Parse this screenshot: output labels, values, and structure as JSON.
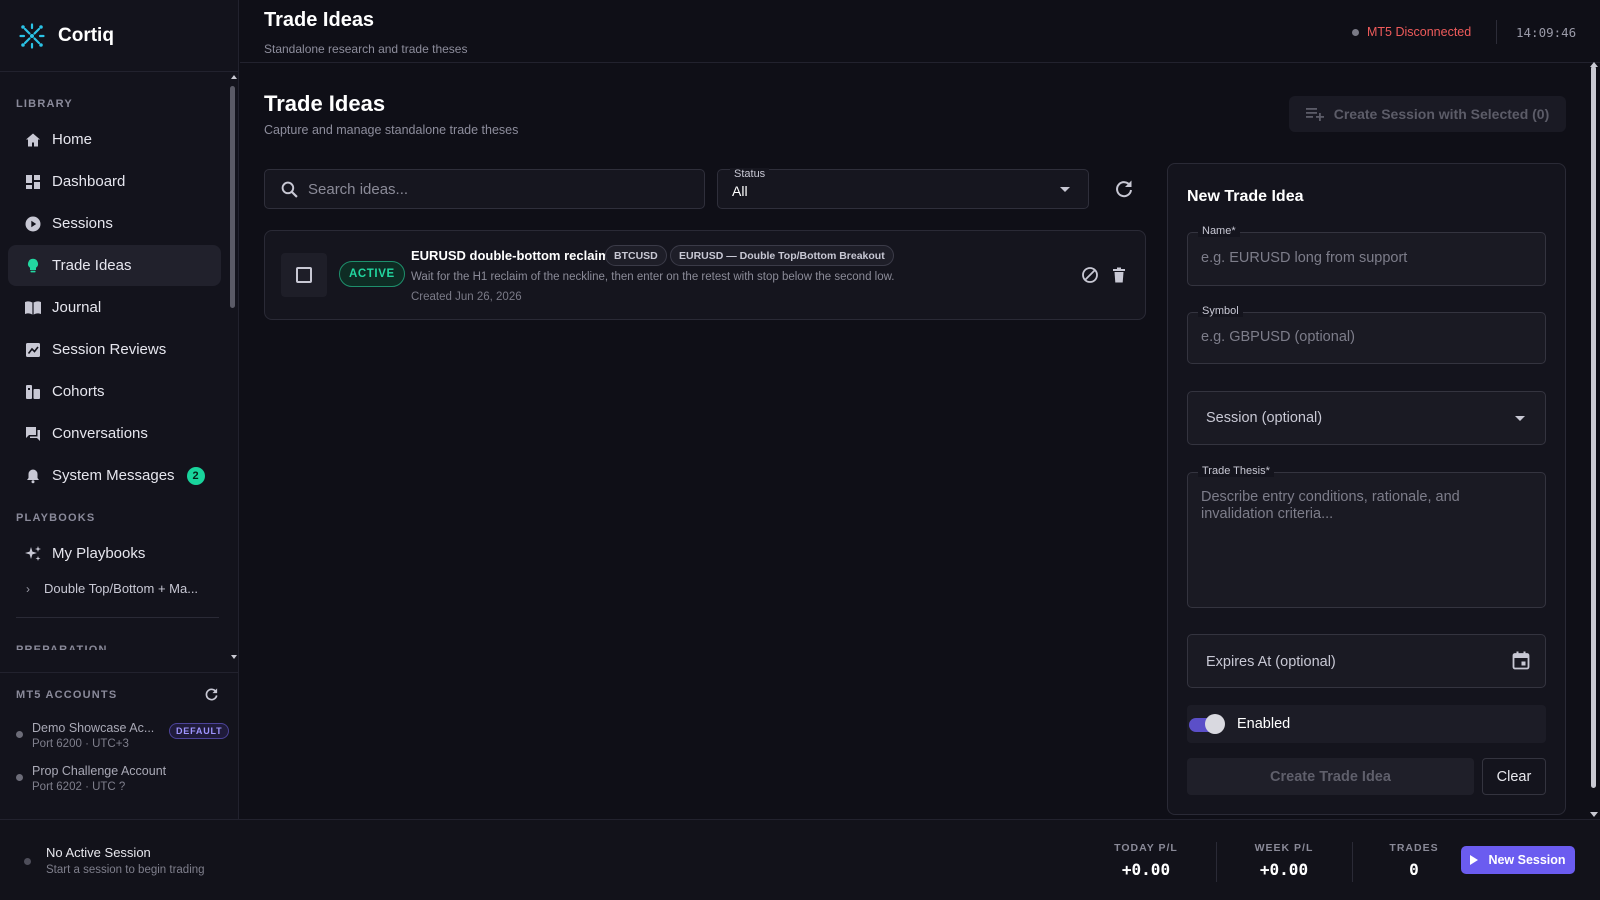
{
  "app": {
    "name": "Cortiq"
  },
  "sidebar": {
    "library_title": "LIBRARY",
    "items": [
      {
        "label": "Home",
        "icon": "home-icon"
      },
      {
        "label": "Dashboard",
        "icon": "dashboard-icon"
      },
      {
        "label": "Sessions",
        "icon": "play-circle-icon"
      },
      {
        "label": "Trade Ideas",
        "icon": "lightbulb-icon",
        "active": true
      },
      {
        "label": "Journal",
        "icon": "book-icon"
      },
      {
        "label": "Session Reviews",
        "icon": "review-icon"
      },
      {
        "label": "Cohorts",
        "icon": "cohorts-icon"
      },
      {
        "label": "Conversations",
        "icon": "chat-icon"
      },
      {
        "label": "System Messages",
        "icon": "bell-icon",
        "badge": "2"
      }
    ],
    "playbooks_title": "PLAYBOOKS",
    "my_playbooks": "My Playbooks",
    "playbook_child": "Double Top/Bottom + Ma...",
    "clipped_section": "PREPARATION",
    "accounts_title": "MT5 ACCOUNTS",
    "accounts": [
      {
        "name": "Demo Showcase Ac...",
        "sub": "Port 6200 · UTC+3",
        "tag": "DEFAULT"
      },
      {
        "name": "Prop Challenge Account",
        "sub": "Port 6202 · UTC ?"
      }
    ]
  },
  "header": {
    "title": "Trade Ideas",
    "subtitle": "Standalone research and trade theses",
    "connection": "MT5 Disconnected",
    "clock": "14:09:46"
  },
  "main": {
    "title": "Trade Ideas",
    "subtitle": "Capture and manage standalone trade theses",
    "create_session_label": "Create Session with Selected (0)",
    "search_placeholder": "Search ideas...",
    "status_label": "Status",
    "status_value": "All",
    "ideas": [
      {
        "status": "ACTIVE",
        "title": "EURUSD double-bottom reclaim",
        "symbol": "BTCUSD",
        "playbook": "EURUSD — Double Top/Bottom Breakout",
        "description": "Wait for the H1 reclaim of the neckline, then enter on the retest with stop below the second low.",
        "created": "Created Jun 26, 2026"
      }
    ]
  },
  "form": {
    "title": "New Trade Idea",
    "name_label": "Name*",
    "name_placeholder": "e.g. EURUSD long from support",
    "symbol_label": "Symbol",
    "symbol_placeholder": "e.g. GBPUSD (optional)",
    "session_placeholder": "Session (optional)",
    "thesis_label": "Trade Thesis*",
    "thesis_placeholder": "Describe entry conditions, rationale, and invalidation criteria...",
    "expires_placeholder": "Expires At (optional)",
    "enabled_label": "Enabled",
    "submit_label": "Create Trade Idea",
    "clear_label": "Clear"
  },
  "footer": {
    "session_title": "No Active Session",
    "session_sub": "Start a session to begin trading",
    "today_label": "TODAY P/L",
    "today_value": "+0.00",
    "week_label": "WEEK P/L",
    "week_value": "+0.00",
    "trades_label": "TRADES",
    "trades_value": "0",
    "new_session_label": "New Session"
  },
  "colors": {
    "accent": "#6b5cf0",
    "active_green": "#22d7a0",
    "disconnected_red": "#ef5b5b",
    "background": "#0f0f17"
  }
}
